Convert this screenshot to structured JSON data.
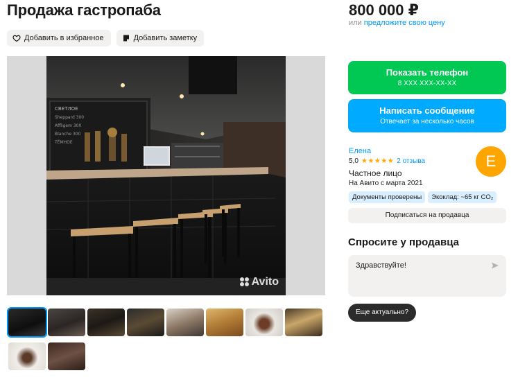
{
  "listing": {
    "title": "Продажа гастропаба",
    "price": "800 000 ₽",
    "offer_prefix": "или",
    "offer_link": "предложите свою цену"
  },
  "actions": {
    "favorite": "Добавить в избранное",
    "note": "Добавить заметку"
  },
  "gallery": {
    "watermark": "Avito"
  },
  "contact": {
    "phone_title": "Показать телефон",
    "phone_masked": "8 XXX XXX-XX-XX",
    "message_title": "Написать сообщение",
    "message_sub": "Отвечает за несколько часов"
  },
  "seller": {
    "name": "Елена",
    "rating": "5,0",
    "stars": "★★★★★",
    "reviews": "2 отзыва",
    "type": "Частное лицо",
    "since": "На Авито с марта 2021",
    "avatar_letter": "E",
    "badges": [
      "Документы проверены",
      "Экоклад: ~65 кг CO₂"
    ],
    "subscribe": "Подписаться на продавца"
  },
  "ask": {
    "heading": "Спросите у продавца",
    "message": "Здравствуйте!",
    "quick_reply": "Еще актуально?"
  },
  "colors": {
    "green": "#00c853",
    "blue": "#00aaff",
    "link": "#0099f7",
    "avatar": "#ffa500",
    "star": "#ffa800"
  }
}
